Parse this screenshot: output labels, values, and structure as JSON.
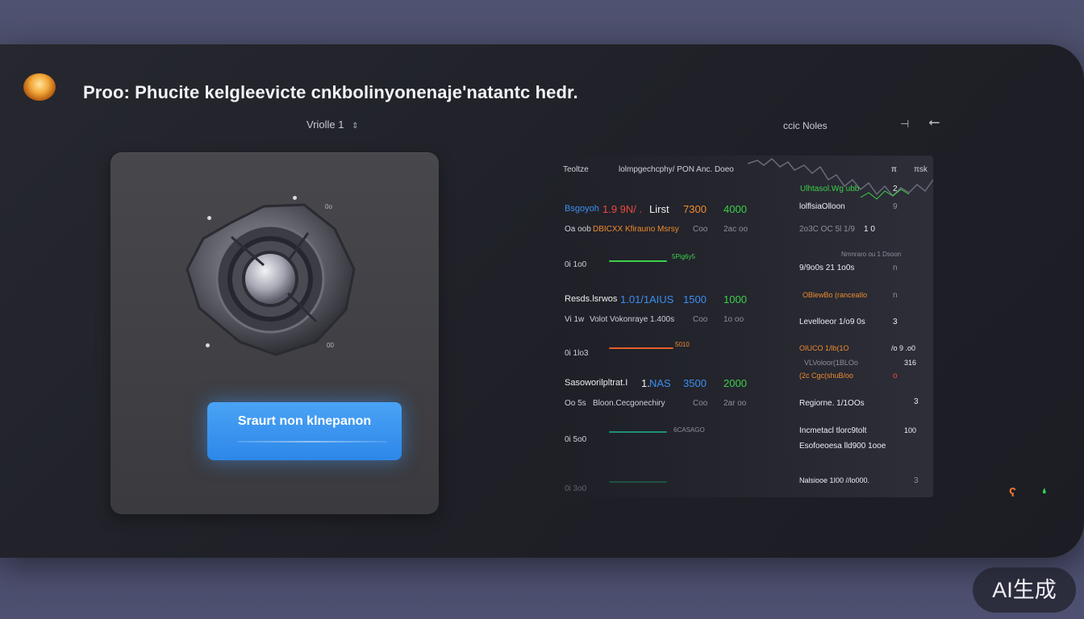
{
  "window": {
    "title": "Proo: Phucite kelgleevicte cnkbolinyonenaje'natantc hedr.",
    "mode_label": "Vriolle 1",
    "notes_label": "ccic Noles",
    "notes_minus": "⊣",
    "notes_back": "⭠"
  },
  "control_panel": {
    "knob_tick_top": "0o",
    "knob_tick_bottom": "00",
    "start_button_label": "Sraurt non klnepanon"
  },
  "table": {
    "header": {
      "col1": "Teoltze",
      "col2": "lolmpgechcphy/ PON  Anc. Doeo",
      "col3": "π",
      "col4": "πsk"
    },
    "groups": [
      {
        "title_blue": "Bsgoyoh",
        "title_red": "1.9 9N/ .",
        "title_tag": "Lirst",
        "title_val": "7300",
        "target": "4000",
        "subtitle_a": "Oa oob",
        "subtitle_b": "DBICXX Kfirauno Msrsy",
        "subtitle_c": "Coo",
        "subtitle_d": "2ac oo",
        "row_label": "0i 1o0",
        "spark_label": "5Pig6y5",
        "accent": "#3cd14a"
      },
      {
        "title_blue": "Resds.lsrwos",
        "title_red": "1.01/1",
        "title_tag": "AIUS",
        "title_val": "1500",
        "target": "1000",
        "subtitle_a": "Vi 1w",
        "subtitle_b": "Volot Vokonraye  1.400s",
        "subtitle_c": "Coo",
        "subtitle_d": "1o oo",
        "row_label": "0i 1lo3",
        "spark_label": "5010",
        "accent": "#e35f2d"
      },
      {
        "title_blue": "Sasoworilpltrat.I",
        "title_red": "1.",
        "title_tag": "NAS",
        "title_val": "3500",
        "target": "2000",
        "subtitle_a": "Oo 5s",
        "subtitle_b": "Bloon.Cecgonechiry",
        "subtitle_c": "Coo",
        "subtitle_d": "2ar oo",
        "row_label": "0i 5o0",
        "spark_label": "6CASAGO",
        "accent": "#1f8f73"
      }
    ],
    "footer_row_label": "0i 3o0",
    "right_rows": [
      {
        "label": "Ulhtasol.Wg ubb",
        "val": "2",
        "tone": "green"
      },
      {
        "label": "lolflsiaOlloon",
        "val": "9",
        "tone": "white"
      },
      {
        "label": "2o3C OC 5l 1/9",
        "val": "1   0",
        "tone": "dim"
      },
      {
        "label": "Nmnraro ou 1 Dsoon",
        "val": "",
        "tone": "dim"
      },
      {
        "label": "9/9o0s 21 1o0s",
        "val": "n",
        "tone": "white"
      },
      {
        "label": "OBlewBo (ranceaIlo",
        "val": "n",
        "tone": "orange"
      },
      {
        "label": "Levelloeor 1/o9 0s",
        "val": "3",
        "tone": "white"
      },
      {
        "label": "OIUCO 1/lb(1O",
        "val": "/o  9 .o0",
        "tone": "orange"
      },
      {
        "label": "VLVoloor(1BLOo",
        "val": "316",
        "tone": "dim"
      },
      {
        "label": "(2c  Cgc(shuB/oo",
        "val": "o",
        "tone": "orange"
      },
      {
        "label": "Regiorne. 1/1OOs",
        "val": "3",
        "tone": "white"
      },
      {
        "label": "Incmetacl tlorc9tolt",
        "val": "100",
        "tone": "white"
      },
      {
        "label": "Esofoeoesa lld900 1ooe",
        "val": "",
        "tone": "white"
      },
      {
        "label": "Nalsiooe 1I00 //lo000.",
        "val": "3",
        "tone": "white"
      }
    ]
  },
  "watermark": "AI生成",
  "colors": {
    "accent_blue": "#2d87e8",
    "panel_bg": "#1f2027",
    "green": "#3cd14a",
    "orange": "#f08c2e",
    "red": "#ef4a3c"
  }
}
